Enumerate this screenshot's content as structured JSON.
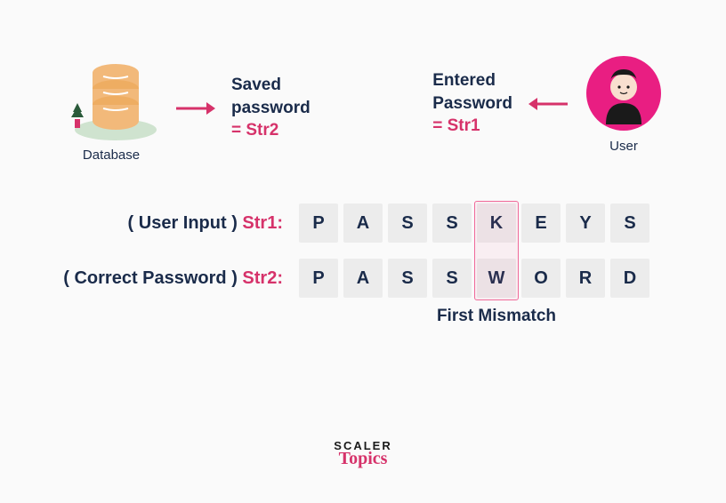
{
  "top": {
    "database_label": "Database",
    "saved_pw_line1": "Saved",
    "saved_pw_line2": "password",
    "saved_pw_eq": "= Str2",
    "entered_pw_line1": "Entered",
    "entered_pw_line2": "Password",
    "entered_pw_eq": "= Str1",
    "user_label": "User"
  },
  "rows": {
    "str1_label_prefix": "( User Input ) ",
    "str1_name": "Str1:",
    "str1_cells": [
      "P",
      "A",
      "S",
      "S",
      "K",
      "E",
      "Y",
      "S"
    ],
    "str2_label_prefix": "( Correct Password ) ",
    "str2_name": "Str2:",
    "str2_cells": [
      "P",
      "A",
      "S",
      "S",
      "W",
      "O",
      "R",
      "D"
    ],
    "mismatch_index": 4,
    "mismatch_label": "First Mismatch"
  },
  "logo": {
    "line1": "SCALER",
    "line2": "Topics"
  },
  "colors": {
    "accent": "#d6326a",
    "db_orange": "#f2b97a",
    "user_pink": "#e91e82",
    "text": "#1a2b4a"
  }
}
